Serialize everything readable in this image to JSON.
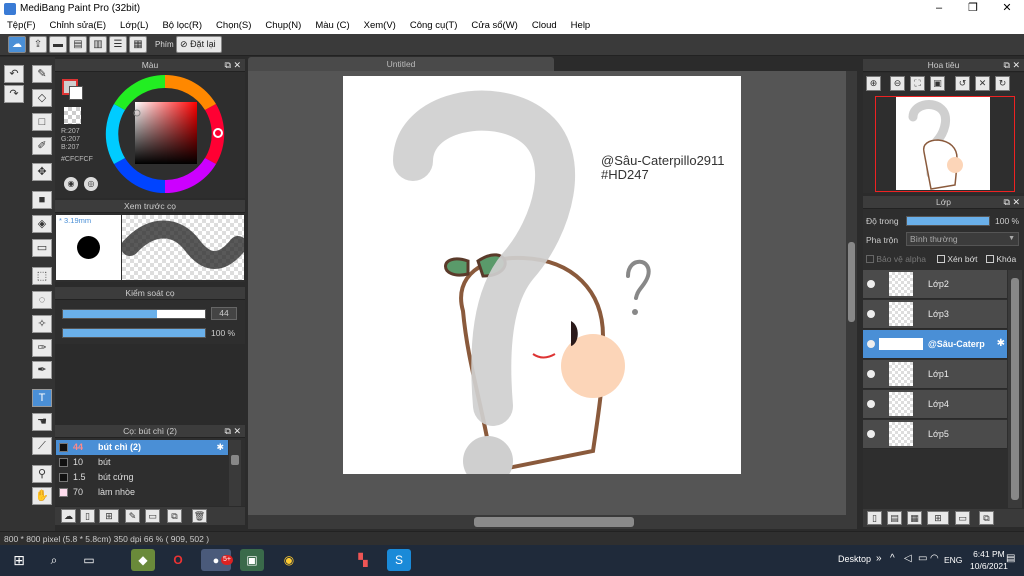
{
  "window": {
    "title": "MediBang Paint Pro (32bit)",
    "minimize": "–",
    "maximize": "❐",
    "close": "✕"
  },
  "menu": [
    "Tệp(F)",
    "Chỉnh sửa(E)",
    "Lớp(L)",
    "Bộ lọc(R)",
    "Chọn(S)",
    "Chụp(N)",
    "Màu (C)",
    "Xem(V)",
    "Công cụ(T)",
    "Cửa sổ(W)",
    "Cloud",
    "Help"
  ],
  "toolbar": {
    "phim_label": "Phím",
    "reset_label": "Đặt lại"
  },
  "color_panel": {
    "title": "Màu",
    "r": "R:207",
    "g": "G:207",
    "b": "B:207",
    "hex": "#CFCFCF",
    "current_color": "#cfcfcf"
  },
  "brush_preview": {
    "title": "Xem trước cọ",
    "size": "3.19mm"
  },
  "brush_control": {
    "title": "Kiểm soát cọ",
    "size_value": "44",
    "size_fraction": 0.66,
    "opacity_value": "100 %",
    "opacity_fraction": 1.0
  },
  "brush_list": {
    "title": "Cọ: bút chì (2)",
    "items": [
      {
        "size": "44",
        "name": "bút chì (2)",
        "selected": true
      },
      {
        "size": "10",
        "name": "bút"
      },
      {
        "size": "1.5",
        "name": "bút cứng"
      },
      {
        "size": "70",
        "name": "làm nhòe"
      }
    ]
  },
  "canvas": {
    "tab_title": "Untitled",
    "text_line1": "@Sâu-Caterpillo2911",
    "text_line2": "#HD247"
  },
  "navigator": {
    "title": "Hoa tiêu"
  },
  "layers": {
    "title": "Lớp",
    "opacity_label": "Độ trong",
    "opacity_value": "100 %",
    "opacity_fraction": 1.0,
    "blend_label": "Pha trộn",
    "blend_value": "Bình thường",
    "protect_alpha": "Bảo vệ alpha",
    "clipping": "Xén bớt",
    "lock": "Khóa",
    "items": [
      {
        "name": "Lớp2"
      },
      {
        "name": "Lớp3"
      },
      {
        "name": "@Sâu-Caterp",
        "selected": true
      },
      {
        "name": "Lớp1"
      },
      {
        "name": "Lớp4"
      },
      {
        "name": "Lớp5"
      }
    ]
  },
  "status": {
    "text": "800 * 800 pixel   (5.8 * 5.8cm)   350 dpi   66 %   ( 909, 502 )"
  },
  "taskbar": {
    "desktop": "Desktop",
    "lang": "ENG",
    "time": "6:41 PM",
    "date": "10/6/2021",
    "badge": "5+"
  }
}
